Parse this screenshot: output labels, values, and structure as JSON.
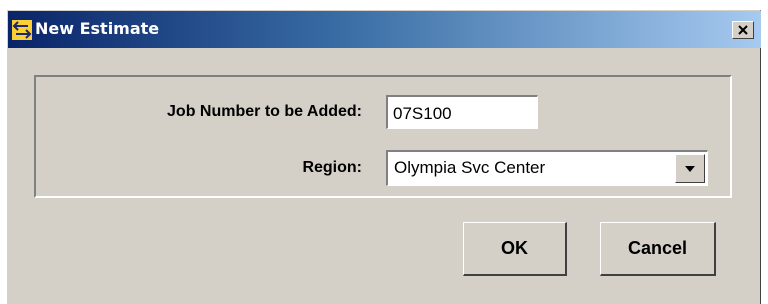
{
  "window": {
    "title": "New Estimate",
    "app_icon": "arrows-icon",
    "close_icon": "close-icon"
  },
  "form": {
    "job_number_label": "Job Number to be Added:",
    "job_number_value": "07S100",
    "region_label": "Region:",
    "region_selected": "Olympia Svc Center"
  },
  "buttons": {
    "ok_label": "OK",
    "cancel_label": "Cancel"
  },
  "colors": {
    "titlebar_start": "#0a246a",
    "titlebar_end": "#a6caf0",
    "dialog_face": "#d4d0c8"
  }
}
